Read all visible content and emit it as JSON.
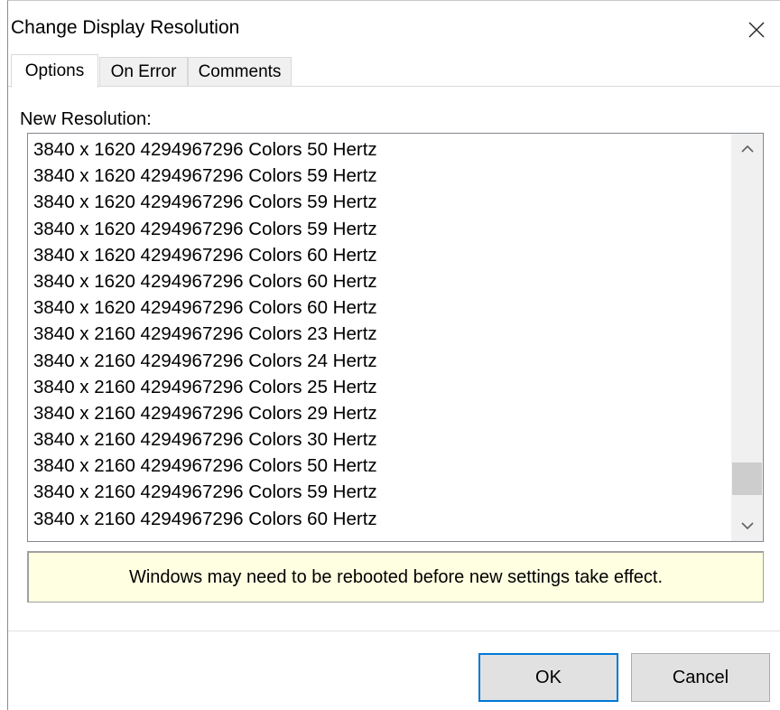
{
  "window": {
    "title": "Change Display Resolution"
  },
  "tabs": [
    {
      "label": "Options",
      "active": true
    },
    {
      "label": "On Error",
      "active": false
    },
    {
      "label": "Comments",
      "active": false
    }
  ],
  "options": {
    "new_resolution_label": "New Resolution:",
    "resolutions": [
      "3840 x 1620 4294967296 Colors 50 Hertz",
      "3840 x 1620 4294967296 Colors 59 Hertz",
      "3840 x 1620 4294967296 Colors 59 Hertz",
      "3840 x 1620 4294967296 Colors 59 Hertz",
      "3840 x 1620 4294967296 Colors 60 Hertz",
      "3840 x 1620 4294967296 Colors 60 Hertz",
      "3840 x 1620 4294967296 Colors 60 Hertz",
      "3840 x 2160 4294967296 Colors 23 Hertz",
      "3840 x 2160 4294967296 Colors 24 Hertz",
      "3840 x 2160 4294967296 Colors 25 Hertz",
      "3840 x 2160 4294967296 Colors 29 Hertz",
      "3840 x 2160 4294967296 Colors 30 Hertz",
      "3840 x 2160 4294967296 Colors 50 Hertz",
      "3840 x 2160 4294967296 Colors 59 Hertz",
      "3840 x 2160 4294967296 Colors 60 Hertz"
    ],
    "scroll_position": 0.95,
    "notice": "Windows may need to be rebooted before new settings take effect."
  },
  "buttons": {
    "ok": "OK",
    "cancel": "Cancel"
  },
  "icons": {
    "close": "close-icon",
    "scroll_up": "chevron-up-icon",
    "scroll_down": "chevron-down-icon"
  }
}
